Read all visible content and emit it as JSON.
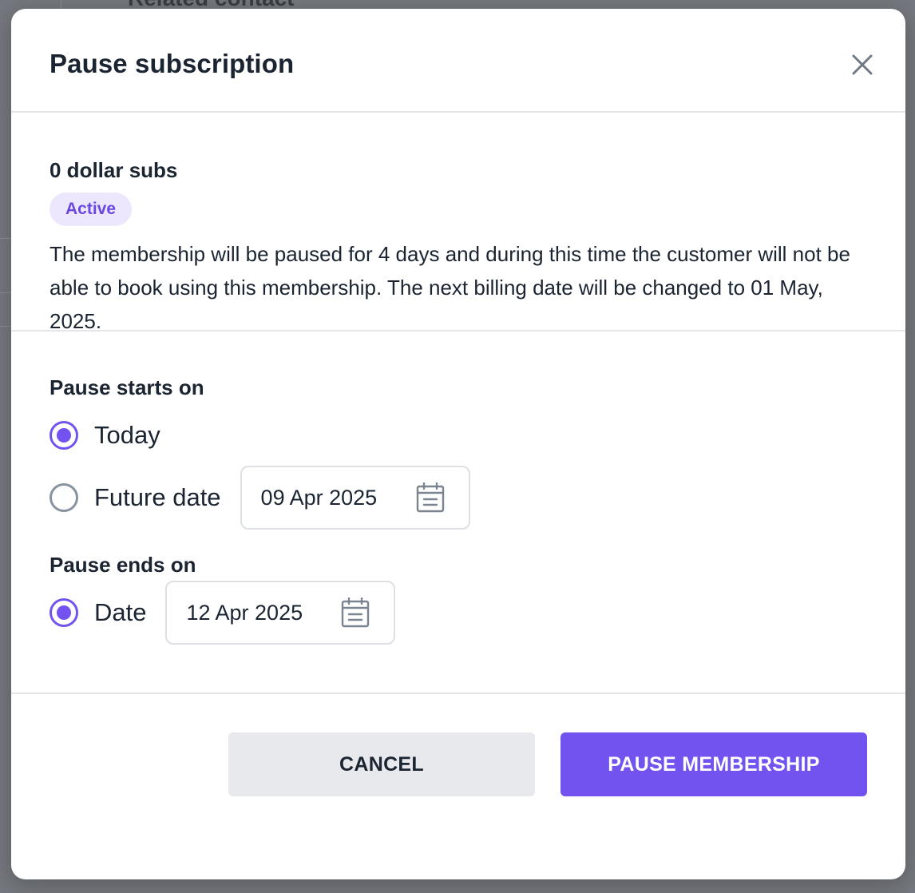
{
  "background": {
    "heading_fragment": "Related contact"
  },
  "modal": {
    "title": "Pause subscription",
    "close_icon": "close-icon"
  },
  "subscription": {
    "name": "0 dollar subs",
    "status": "Active",
    "description": "The membership will be paused for 4 days and during this time the customer will not be able to book using this membership. The next billing date will be changed to 01 May, 2025."
  },
  "pause_start": {
    "label": "Pause starts on",
    "options": [
      {
        "label": "Today",
        "selected": true
      },
      {
        "label": "Future date",
        "selected": false
      }
    ],
    "future_date_value": "09 Apr 2025",
    "calendar_icon": "calendar-icon"
  },
  "pause_end": {
    "label": "Pause ends on",
    "options": [
      {
        "label": "Date",
        "selected": true
      }
    ],
    "date_value": "12 Apr 2025",
    "calendar_icon": "calendar-icon"
  },
  "footer": {
    "cancel_label": "CANCEL",
    "submit_label": "PAUSE MEMBERSHIP"
  },
  "colors": {
    "accent": "#7353f0",
    "badge_bg": "#ede7fd",
    "badge_text": "#6a48e0",
    "text_primary": "#1b2431",
    "divider": "#e3e5e8"
  }
}
